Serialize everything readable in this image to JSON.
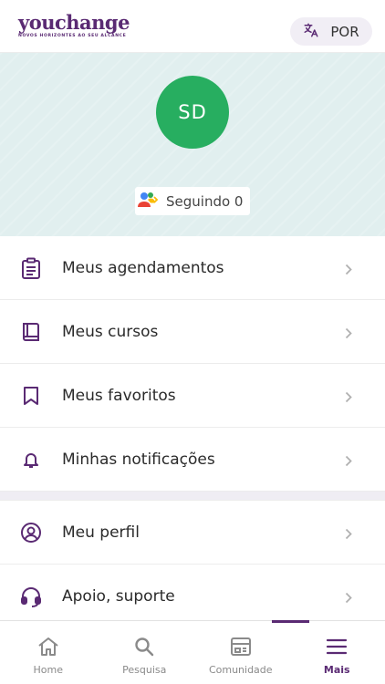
{
  "header": {
    "logo_word": "youchange",
    "logo_tagline": "NOVOS HORIZONTES AO SEU ALCANCE",
    "language_label": "POR",
    "language_icon": "translate-icon"
  },
  "profile": {
    "initials": "SD",
    "avatar_color": "#27ae60",
    "following_label": "Seguindo 0",
    "following_icon": "people-arrow-icon"
  },
  "menu": {
    "items": [
      {
        "label": "Meus agendamentos",
        "icon": "clipboard-icon"
      },
      {
        "label": "Meus cursos",
        "icon": "book-icon"
      },
      {
        "label": "Meus favoritos",
        "icon": "bookmark-icon"
      },
      {
        "label": "Minhas notificações",
        "icon": "bell-icon"
      },
      {
        "label": "Meu perfil",
        "icon": "user-circle-icon"
      },
      {
        "label": "Apoio, suporte",
        "icon": "headset-icon"
      }
    ]
  },
  "bottom_nav": {
    "items": [
      {
        "label": "Home",
        "icon": "home-icon"
      },
      {
        "label": "Pesquisa",
        "icon": "search-icon"
      },
      {
        "label": "Comunidade",
        "icon": "community-icon"
      },
      {
        "label": "Mais",
        "icon": "menu-icon"
      }
    ],
    "active": "Mais"
  },
  "colors": {
    "brand": "#5a2a73",
    "profile_bg": "#e1efef",
    "avatar": "#27ae60"
  }
}
